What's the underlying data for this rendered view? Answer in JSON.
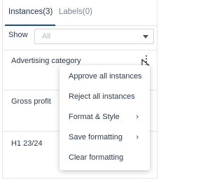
{
  "tabs": [
    {
      "label": "Instances(3)",
      "active": true
    },
    {
      "label": "Labels(0)",
      "active": false
    }
  ],
  "filter": {
    "label": "Show",
    "value": "All"
  },
  "rows": [
    {
      "label": "Advertising category"
    },
    {
      "label": "Gross profit"
    },
    {
      "label": "H1 23/24"
    }
  ],
  "context_menu": {
    "items": [
      {
        "label": "Approve all instances",
        "has_submenu": false
      },
      {
        "label": "Reject all instances",
        "has_submenu": false
      },
      {
        "label": "Format & Style",
        "has_submenu": true,
        "chevron": "›"
      },
      {
        "label": "Save formatting",
        "has_submenu": true,
        "chevron": "›"
      },
      {
        "label": "Clear formatting",
        "has_submenu": false
      }
    ]
  },
  "colors": {
    "accent": "#1b4f7c",
    "text": "#2b3a4a",
    "border": "#e3e6ea"
  }
}
